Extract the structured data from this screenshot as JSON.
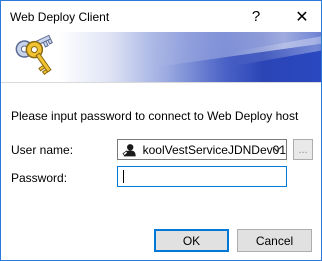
{
  "window": {
    "title": "Web Deploy Client",
    "help_glyph": "?",
    "close_glyph": "✕"
  },
  "banner": {
    "icon": "keys-icon",
    "gradient_end_color": "#2a48c0"
  },
  "form": {
    "prompt": "Please input password to connect to Web Deploy host",
    "username_label": "User name:",
    "username_value": "koolVestServiceJDNDev01",
    "browse_label": "...",
    "password_label": "Password:",
    "password_value": ""
  },
  "buttons": {
    "ok": "OK",
    "cancel": "Cancel"
  },
  "colors": {
    "accent": "#0078d7",
    "window_border": "#2b79d8"
  }
}
